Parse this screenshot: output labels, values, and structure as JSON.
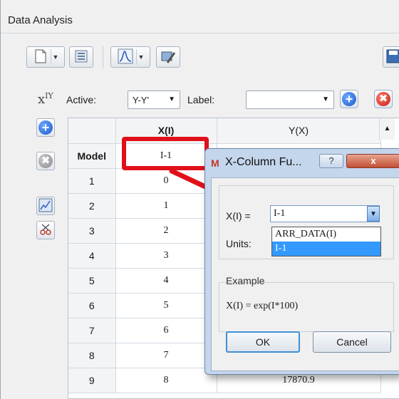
{
  "window": {
    "title": "Data Analysis"
  },
  "toolbar": {
    "buttons": [
      {
        "name": "new-document-icon"
      },
      {
        "name": "copy-data-icon"
      },
      {
        "name": "chart-peak-icon"
      },
      {
        "name": "wrench-tool-icon"
      },
      {
        "name": "save-icon"
      }
    ]
  },
  "selector": {
    "active_label": "Active:",
    "active_value": "Y-Y'",
    "label_label": "Label:",
    "label_value": ""
  },
  "grid": {
    "columns": [
      "",
      "X(I)",
      "Y(X)"
    ],
    "model_row": {
      "header": "Model",
      "xi": "I-1",
      "yx": ""
    },
    "rows": [
      {
        "n": "1",
        "xi": "0",
        "yx": ""
      },
      {
        "n": "2",
        "xi": "1",
        "yx": ""
      },
      {
        "n": "3",
        "xi": "2",
        "yx": ""
      },
      {
        "n": "4",
        "xi": "3",
        "yx": ""
      },
      {
        "n": "5",
        "xi": "4",
        "yx": ""
      },
      {
        "n": "6",
        "xi": "5",
        "yx": ""
      },
      {
        "n": "7",
        "xi": "6",
        "yx": ""
      },
      {
        "n": "8",
        "xi": "7",
        "yx": ""
      },
      {
        "n": "9",
        "xi": "8",
        "yx": "17870.9"
      }
    ]
  },
  "dialog": {
    "title": "X-Column Fu...",
    "help": "?",
    "close": "x",
    "x_label": "X(I) =",
    "x_value": "I-1",
    "units_label": "Units:",
    "options": [
      "ARR_DATA(I)",
      "I-1"
    ],
    "selected_option_index": 1,
    "example_label": "Example",
    "example_text": "X(I) = exp(I*100)",
    "ok": "OK",
    "cancel": "Cancel"
  },
  "colors": {
    "highlight": "#e0101a",
    "selection": "#3399ff",
    "dialog_frame": "#c4d6ec"
  }
}
